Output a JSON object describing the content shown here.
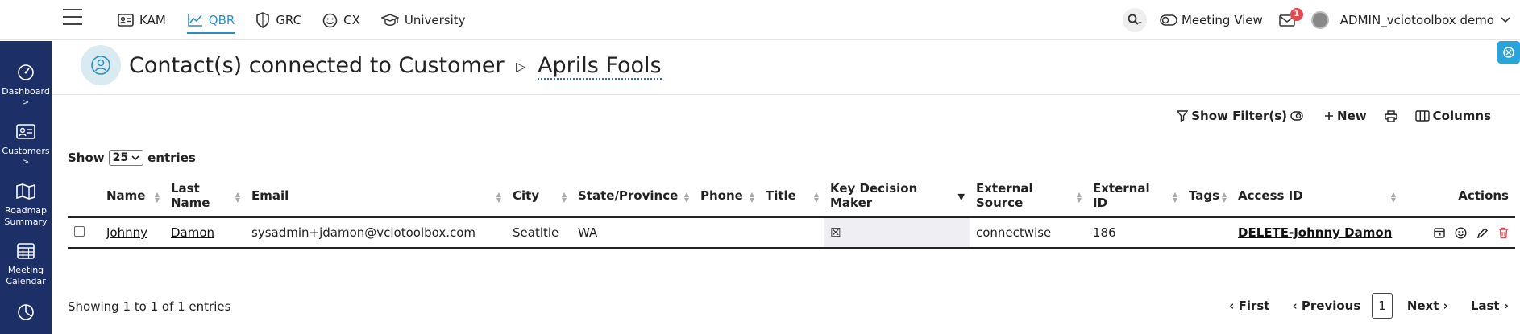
{
  "nav": {
    "items": [
      {
        "label": "KAM",
        "icon": "id-card-icon"
      },
      {
        "label": "QBR",
        "icon": "chart-line-icon",
        "active": true
      },
      {
        "label": "GRC",
        "icon": "shield-icon"
      },
      {
        "label": "CX",
        "icon": "smile-icon"
      },
      {
        "label": "University",
        "icon": "graduation-cap-icon"
      }
    ]
  },
  "topright": {
    "meeting_view": "Meeting View",
    "mail_count": "1",
    "user_name": "ADMIN_vciotoolbox demo"
  },
  "sidebar": {
    "items": [
      {
        "label": "Dashboard",
        "icon": "dashboard-gauge-icon"
      },
      {
        "label": "Customers",
        "icon": "customers-card-icon"
      },
      {
        "label": "Roadmap Summary",
        "icon": "map-icon"
      },
      {
        "label": "Meeting Calendar",
        "icon": "calendar-grid-icon"
      },
      {
        "label": "",
        "icon": "pie-chart-icon"
      }
    ]
  },
  "header": {
    "title": "Contact(s) connected to Customer",
    "customer": "Aprils Fools"
  },
  "toolbar": {
    "filters": "Show Filter(s)",
    "new": "New",
    "columns": "Columns"
  },
  "entries": {
    "show": "Show",
    "value": "25",
    "suffix": "entries"
  },
  "table": {
    "columns": [
      "Name",
      "Last Name",
      "Email",
      "City",
      "State/Province",
      "Phone",
      "Title",
      "Key Decision Maker",
      "External Source",
      "External ID",
      "Tags",
      "Access ID",
      "Actions"
    ],
    "rows": [
      {
        "name": "Johnny",
        "last_name": "Damon",
        "email": "sysadmin+jdamon@vciotoolbox.com",
        "city": "Seatltle",
        "state": "WA",
        "phone": "",
        "title": "",
        "key_decision_maker": "☒",
        "external_source": "connectwise",
        "external_id": "186",
        "tags": "",
        "access_id": "DELETE-Johnny Damon"
      }
    ]
  },
  "footer": {
    "info": "Showing 1 to 1 of 1 entries",
    "first": "First",
    "previous": "Previous",
    "page": "1",
    "next": "Next",
    "last": "Last"
  }
}
